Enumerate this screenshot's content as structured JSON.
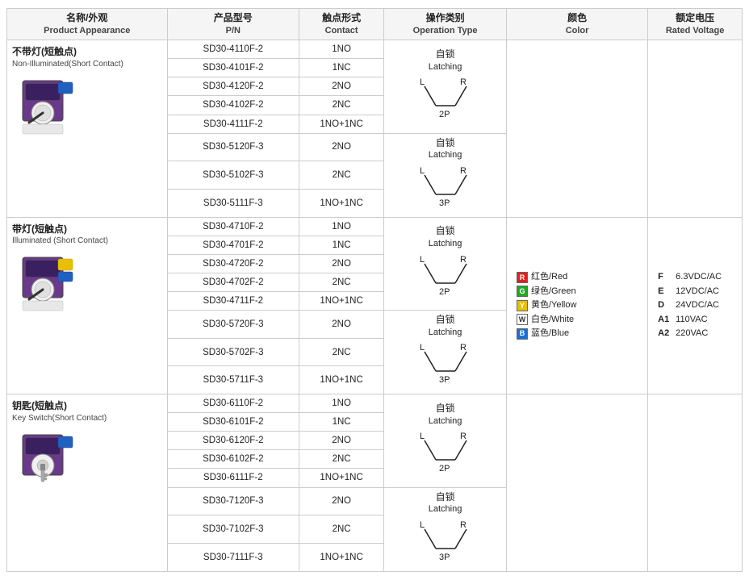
{
  "headers": {
    "appearance_zh": "名称/外观",
    "appearance_en": "Product Appearance",
    "pn_zh": "产品型号",
    "pn_en": "P/N",
    "contact_zh": "触点形式",
    "contact_en": "Contact",
    "optype_zh": "操作类别",
    "optype_en": "Operation Type",
    "color_zh": "颜色",
    "color_en": "Color",
    "voltage_zh": "额定电压",
    "voltage_en": "Rated Voltage"
  },
  "sections": [
    {
      "id": "non-illuminated",
      "title_zh": "不带灯(短触点)",
      "title_en": "Non-Illuminated(Short Contact)",
      "groups": [
        {
          "op_zh": "自锁",
          "op_en": "Latching",
          "diagram": "2P",
          "rows": [
            {
              "pn": "SD30-4110F-2",
              "contact": "1NO"
            },
            {
              "pn": "SD30-4101F-2",
              "contact": "1NC"
            },
            {
              "pn": "SD30-4120F-2",
              "contact": "2NO"
            },
            {
              "pn": "SD30-4102F-2",
              "contact": "2NC"
            },
            {
              "pn": "SD30-4111F-2",
              "contact": "1NO+1NC"
            }
          ]
        },
        {
          "op_zh": "自锁",
          "op_en": "Latching",
          "diagram": "3P",
          "rows": [
            {
              "pn": "SD30-5120F-3",
              "contact": "2NO"
            },
            {
              "pn": "SD30-5102F-3",
              "contact": "2NC"
            },
            {
              "pn": "SD30-5111F-3",
              "contact": "1NO+1NC"
            }
          ]
        }
      ]
    },
    {
      "id": "illuminated",
      "title_zh": "带灯(短触点)",
      "title_en": "Illuminated (Short Contact)",
      "groups": [
        {
          "op_zh": "自锁",
          "op_en": "Latching",
          "diagram": "2P",
          "rows": [
            {
              "pn": "SD30-4710F-2",
              "contact": "1NO"
            },
            {
              "pn": "SD30-4701F-2",
              "contact": "1NC"
            },
            {
              "pn": "SD30-4720F-2",
              "contact": "2NO"
            },
            {
              "pn": "SD30-4702F-2",
              "contact": "2NC"
            },
            {
              "pn": "SD30-4711F-2",
              "contact": "1NO+1NC"
            }
          ]
        },
        {
          "op_zh": "自锁",
          "op_en": "Latching",
          "diagram": "3P",
          "rows": [
            {
              "pn": "SD30-5720F-3",
              "contact": "2NO"
            },
            {
              "pn": "SD30-5702F-3",
              "contact": "2NC"
            },
            {
              "pn": "SD30-5711F-3",
              "contact": "1NO+1NC"
            }
          ]
        }
      ]
    },
    {
      "id": "key-switch",
      "title_zh": "钥匙(短触点)",
      "title_en": "Key Switch(Short Contact)",
      "groups": [
        {
          "op_zh": "自锁",
          "op_en": "Latching",
          "diagram": "2P",
          "rows": [
            {
              "pn": "SD30-6110F-2",
              "contact": "1NO"
            },
            {
              "pn": "SD30-6101F-2",
              "contact": "1NC"
            },
            {
              "pn": "SD30-6120F-2",
              "contact": "2NO"
            },
            {
              "pn": "SD30-6102F-2",
              "contact": "2NC"
            },
            {
              "pn": "SD30-6111F-2",
              "contact": "1NO+1NC"
            }
          ]
        },
        {
          "op_zh": "自锁",
          "op_en": "Latching",
          "diagram": "3P",
          "rows": [
            {
              "pn": "SD30-7120F-3",
              "contact": "2NO"
            },
            {
              "pn": "SD30-7102F-3",
              "contact": "2NC"
            },
            {
              "pn": "SD30-7111F-3",
              "contact": "1NO+1NC"
            }
          ]
        }
      ]
    }
  ],
  "colors": [
    {
      "code": "R",
      "bg": "#e02020",
      "zh": "红色/Red"
    },
    {
      "code": "G",
      "bg": "#22aa22",
      "zh": "绿色/Green"
    },
    {
      "code": "Y",
      "bg": "#e8c000",
      "zh": "黄色/Yellow"
    },
    {
      "code": "W",
      "bg": "#ffffff",
      "textColor": "#333",
      "zh": "白色/White"
    },
    {
      "code": "B",
      "bg": "#1a6fd4",
      "zh": "蓝色/Blue"
    }
  ],
  "voltages": [
    {
      "key": "F",
      "value": "6.3VDC/AC"
    },
    {
      "key": "E",
      "value": "12VDC/AC"
    },
    {
      "key": "D",
      "value": "24VDC/AC"
    },
    {
      "key": "A1",
      "value": "110VAC"
    },
    {
      "key": "A2",
      "value": "220VAC"
    }
  ]
}
